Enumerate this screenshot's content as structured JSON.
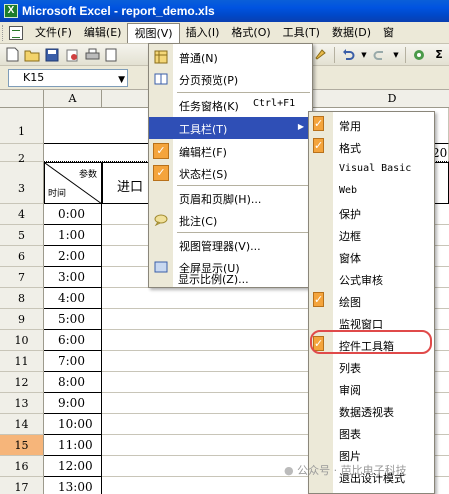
{
  "window": {
    "title": "Microsoft Excel - report_demo.xls",
    "app_icon": "X"
  },
  "menubar": {
    "items": [
      {
        "label": "文件(F)"
      },
      {
        "label": "编辑(E)"
      },
      {
        "label": "视图(V)"
      },
      {
        "label": "插入(I)"
      },
      {
        "label": "格式(O)"
      },
      {
        "label": "工具(T)"
      },
      {
        "label": "数据(D)"
      },
      {
        "label": "窗"
      }
    ]
  },
  "formula": {
    "namebox": "K15"
  },
  "grid": {
    "columns": [
      "A",
      "D"
    ],
    "rows": [
      "1",
      "2",
      "3",
      "4",
      "5",
      "6",
      "7",
      "8",
      "9",
      "10",
      "11",
      "12",
      "13",
      "14",
      "15",
      "16",
      "17"
    ],
    "selected_row": "15",
    "header_params": "参数",
    "header_time": "时间",
    "header_inlet": "进口",
    "b2_partial": "20",
    "times": [
      "0:00",
      "1:00",
      "2:00",
      "3:00",
      "4:00",
      "5:00",
      "6:00",
      "7:00",
      "8:00",
      "9:00",
      "10:00",
      "11:00",
      "12:00",
      "13:00"
    ]
  },
  "view_menu": {
    "items": [
      {
        "label": "普通(N)",
        "icon": "normal-view-icon"
      },
      {
        "label": "分页预览(P)",
        "icon": "page-break-icon"
      },
      {
        "label": "任务窗格(K)",
        "shortcut": "Ctrl+F1"
      },
      {
        "label": "工具栏(T)",
        "highlighted": true
      },
      {
        "label": "编辑栏(F)",
        "checked": true
      },
      {
        "label": "状态栏(S)",
        "checked": true
      },
      {
        "label": "页眉和页脚(H)..."
      },
      {
        "label": "批注(C)",
        "icon": "comment-icon"
      },
      {
        "label": "视图管理器(V)..."
      },
      {
        "label": "全屏显示(U)",
        "icon": "fullscreen-icon"
      },
      {
        "label": "显示比例(Z)..."
      }
    ]
  },
  "toolbars_menu": {
    "items": [
      {
        "label": "常用",
        "checked": true
      },
      {
        "label": "格式",
        "checked": true
      },
      {
        "label": "Visual Basic"
      },
      {
        "label": "Web"
      },
      {
        "label": "保护"
      },
      {
        "label": "边框"
      },
      {
        "label": "窗体"
      },
      {
        "label": "公式审核"
      },
      {
        "label": "绘图",
        "checked": true
      },
      {
        "label": "监视窗口"
      },
      {
        "label": "控件工具箱",
        "checked": true,
        "circled": true
      },
      {
        "label": "列表"
      },
      {
        "label": "审阅"
      },
      {
        "label": "数据透视表"
      },
      {
        "label": "图表"
      },
      {
        "label": "图片"
      },
      {
        "label": "退出设计模式"
      }
    ]
  },
  "watermark": "公众号 · 芭比电子科技",
  "colors": {
    "title_bar": "#0053e0",
    "menu_highlight": "#2f4fb6",
    "check_orange": "#f4a43c",
    "circle_red": "#e04a4a",
    "selected_row": "#f6b57a"
  }
}
